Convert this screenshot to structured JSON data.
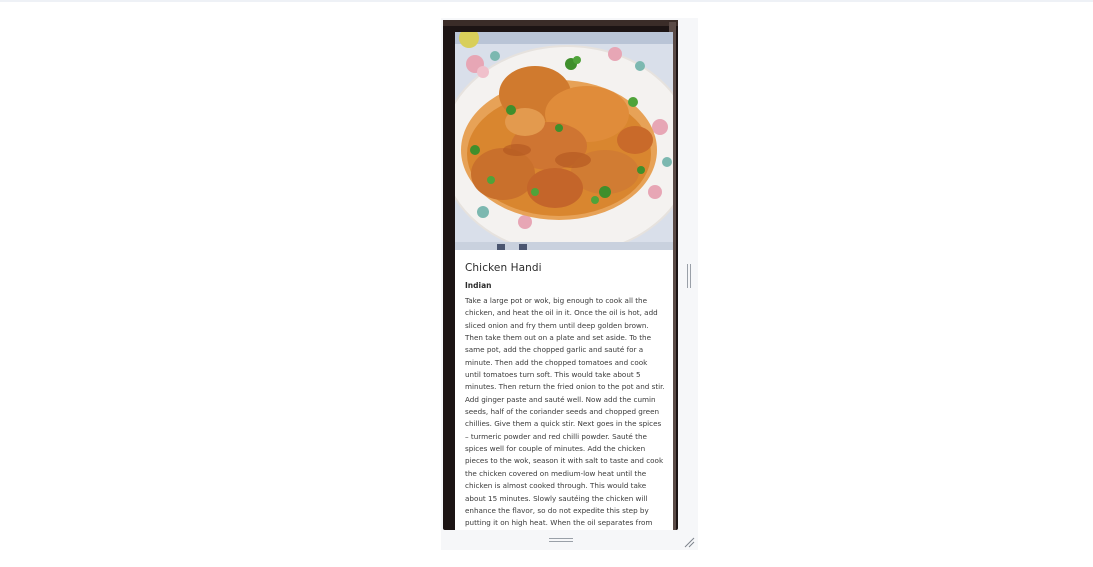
{
  "recipe": {
    "title": "Chicken Handi",
    "cuisine": "Indian",
    "instructions": "Take a large pot or wok, big enough to cook all the chicken, and heat the oil in it. Once the oil is hot, add sliced onion and fry them until deep golden brown. Then take them out on a plate and set aside. To the same pot, add the chopped garlic and sauté for a minute. Then add the chopped tomatoes and cook until tomatoes turn soft. This would take about 5 minutes. Then return the fried onion to the pot and stir. Add ginger paste and sauté well. Now add the cumin seeds, half of the coriander seeds and chopped green chillies. Give them a quick stir. Next goes in the spices – turmeric powder and red chilli powder. Sauté the spices well for couple of minutes. Add the chicken pieces to the wok, season it with salt to taste and cook the chicken covered on medium-low heat until the chicken is almost cooked through. This would take about 15 minutes. Slowly sautéing the chicken will enhance the flavor, so do not expedite this step by putting it on high heat. When the oil separates from",
    "image_icon": "food-photo"
  },
  "colors": {
    "frame": "#1c1414",
    "card_bg": "#ffffff",
    "page_bg": "#ffffff",
    "canvas_bg": "#f6f7f9"
  }
}
